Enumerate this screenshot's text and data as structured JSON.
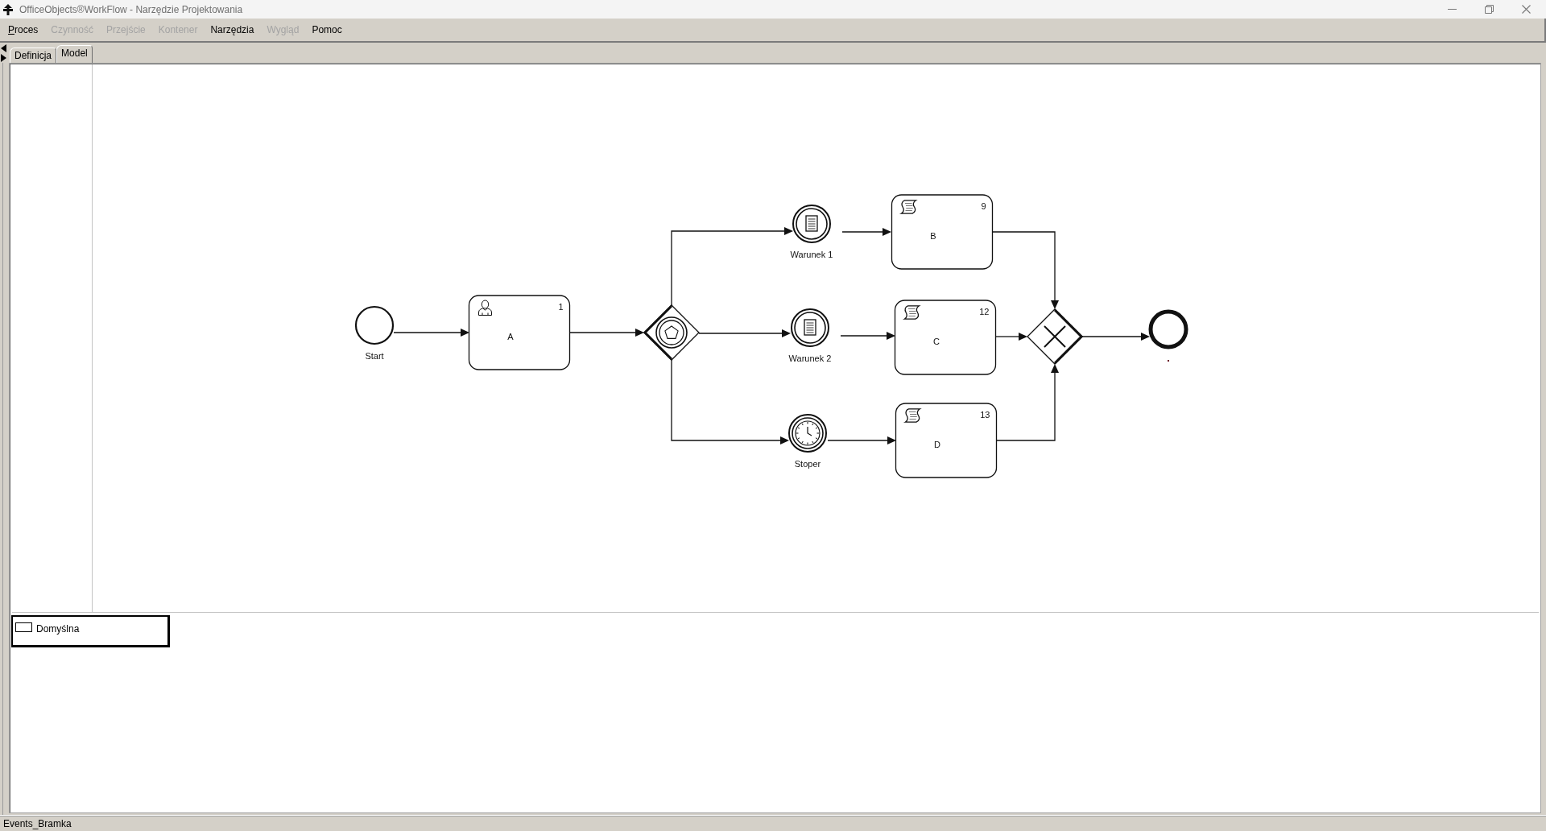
{
  "window": {
    "title": "OfficeObjects®WorkFlow - Narzędzie Projektowania"
  },
  "menu_bar": [
    {
      "label": "Proces",
      "disabled": false,
      "mnemonic_shown": true
    },
    {
      "label": "Czynność",
      "disabled": true,
      "mnemonic_shown": false
    },
    {
      "label": "Przejście",
      "disabled": true,
      "mnemonic_shown": false
    },
    {
      "label": "Kontener",
      "disabled": true,
      "mnemonic_shown": false
    },
    {
      "label": "Narzędzia",
      "disabled": false,
      "mnemonic_shown": false
    },
    {
      "label": "Wygląd",
      "disabled": true,
      "mnemonic_shown": false
    },
    {
      "label": "Pomoc",
      "disabled": false,
      "mnemonic_shown": false
    }
  ],
  "tabs": [
    {
      "label": "Definicja",
      "selected": false
    },
    {
      "label": "Model",
      "selected": true
    }
  ],
  "diagram": {
    "nodes": [
      {
        "kind": "start_event",
        "label": "Start"
      },
      {
        "kind": "user_task",
        "label": "A",
        "number": "1"
      },
      {
        "kind": "event_based_gateway"
      },
      {
        "kind": "conditional_event",
        "label": "Warunek 1"
      },
      {
        "kind": "script_task",
        "label": "B",
        "number": "9"
      },
      {
        "kind": "conditional_event",
        "label": "Warunek 2"
      },
      {
        "kind": "script_task",
        "label": "C",
        "number": "12"
      },
      {
        "kind": "timer_event",
        "label": "Stoper"
      },
      {
        "kind": "script_task",
        "label": "D",
        "number": "13"
      },
      {
        "kind": "exclusive_gateway"
      },
      {
        "kind": "end_event"
      }
    ]
  },
  "lanes": [
    {
      "label": "Domyślna"
    }
  ],
  "status_bar": {
    "text": "Events_Bramka"
  }
}
